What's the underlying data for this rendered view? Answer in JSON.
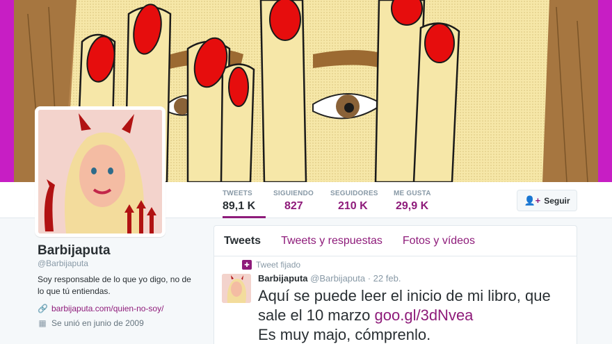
{
  "profile": {
    "name": "Barbijaputa",
    "handle": "@Barbijaputa",
    "bio": "Soy responsable de lo que yo digo, no de lo que tú entiendas.",
    "url": "barbijaputa.com/quien-no-soy/",
    "joined": "Se unió en junio de 2009"
  },
  "stats": [
    {
      "label": "TWEETS",
      "value": "89,1 K"
    },
    {
      "label": "SIGUIENDO",
      "value": "827"
    },
    {
      "label": "SEGUIDORES",
      "value": "210 K"
    },
    {
      "label": "ME GUSTA",
      "value": "29,9 K"
    }
  ],
  "follow_button": {
    "label": "Seguir",
    "icon": "add-user-icon"
  },
  "tabs": [
    "Tweets",
    "Tweets y respuestas",
    "Fotos y vídeos"
  ],
  "tweet": {
    "pinned_label": "Tweet fijado",
    "author_name": "Barbijaputa",
    "author_handle": "@Barbijaputa",
    "date": "· 22 feb.",
    "line1": "Aquí se puede leer el inicio de mi libro, que",
    "line2_prefix": "sale el 10 marzo ",
    "link": "goo.gl/3dNvea",
    "line3": "Es muy majo, cómprenlo."
  },
  "icons": {
    "link": "link-icon",
    "calendar": "calendar-icon",
    "pin": "pin-icon"
  },
  "colors": {
    "accent": "#8e1b7a",
    "header_bg": "#c71ec4",
    "nail": "#e60d0d"
  }
}
